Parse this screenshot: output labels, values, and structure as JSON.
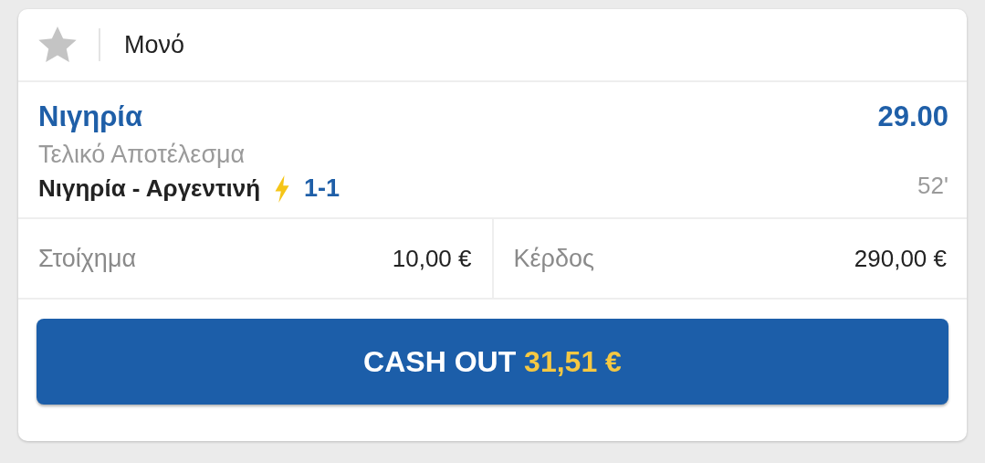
{
  "bet_type": {
    "label": "Μονό",
    "favorite": false
  },
  "selection": {
    "name": "Νιγηρία",
    "odds": "29.00",
    "market": "Τελικό Αποτέλεσμα",
    "match": "Νιγηρία - Αργεντινή",
    "live": true,
    "score": "1-1",
    "minute": "52'"
  },
  "amounts": [
    {
      "label": "Στοίχημα",
      "value": "10,00 €"
    },
    {
      "label": "Κέρδος",
      "value": "290,00 €"
    }
  ],
  "cash_out": {
    "label": "CASH OUT",
    "amount": "31,51 €"
  }
}
